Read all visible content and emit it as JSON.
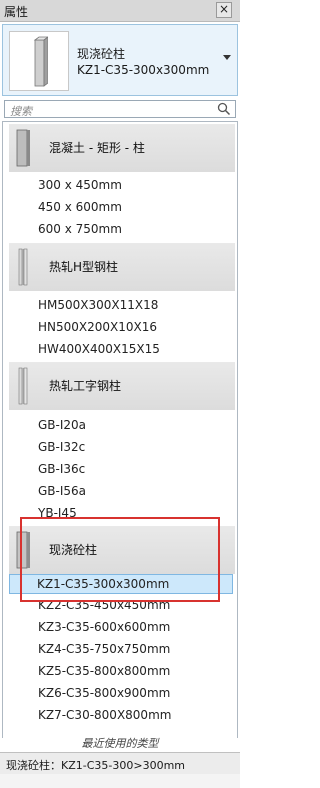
{
  "panel": {
    "title": "属性",
    "close_glyph": "×"
  },
  "type_selector": {
    "family": "现浇砼柱",
    "type": "KZ1-C35-300x300mm"
  },
  "search": {
    "placeholder": "搜索"
  },
  "groups": [
    {
      "label": "混凝土 - 矩形 - 柱",
      "items": [
        "300 x 450mm",
        "450 x 600mm",
        "600 x 750mm"
      ]
    },
    {
      "label": "热轧H型钢柱",
      "items": [
        "HM500X300X11X18",
        "HN500X200X10X16",
        "HW400X400X15X15"
      ]
    },
    {
      "label": "热轧工字钢柱",
      "items": [
        "GB-I20a",
        "GB-I32c",
        "GB-I36c",
        "GB-I56a",
        "YB-I45"
      ]
    },
    {
      "label": "现浇砼柱",
      "items": [
        "KZ1-C35-300x300mm",
        "KZ2-C35-450x450mm",
        "KZ3-C35-600x600mm",
        "KZ4-C35-750x750mm",
        "KZ5-C35-800x800mm",
        "KZ6-C35-800x900mm",
        "KZ7-C30-800X800mm"
      ]
    }
  ],
  "selected_item": "KZ1-C35-300x300mm",
  "recent_label": "最近使用的类型",
  "status": {
    "text": "现浇砼柱：KZ1-C35-300>300mm"
  },
  "colors": {
    "selection": "#cde8fb",
    "selection_border": "#7fb7e2",
    "highlight_box": "#d8322f"
  }
}
